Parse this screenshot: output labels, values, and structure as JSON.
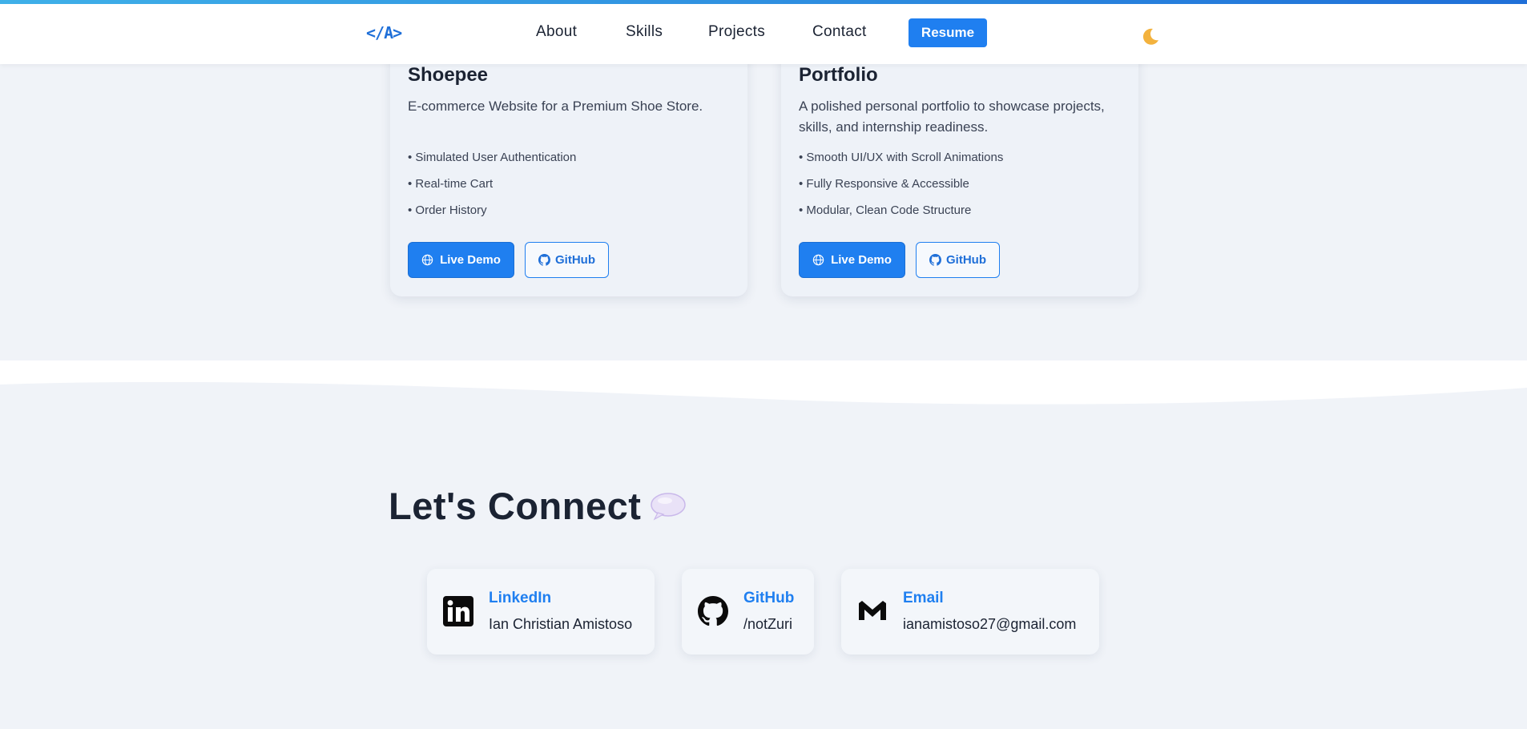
{
  "nav": {
    "logo": "</A>",
    "links": [
      "About",
      "Skills",
      "Projects",
      "Contact"
    ],
    "resume": "Resume",
    "theme_toggle_icon": "moon-icon"
  },
  "projects": [
    {
      "title": "Shoepee",
      "description": "E-commerce Website for a Premium Shoe Store.",
      "features": [
        "• Simulated User Authentication",
        "• Real-time Cart",
        "• Order History"
      ],
      "demo_label": "Live Demo",
      "github_label": "GitHub"
    },
    {
      "title": "Portfolio",
      "description": "A polished personal portfolio to showcase projects, skills, and internship readiness.",
      "features": [
        "• Smooth UI/UX with Scroll Animations",
        "• Fully Responsive & Accessible",
        "• Modular, Clean Code Structure"
      ],
      "demo_label": "Live Demo",
      "github_label": "GitHub"
    }
  ],
  "connect": {
    "title": "Let's Connect",
    "title_icon": "speech-bubble-icon",
    "contacts": [
      {
        "label": "LinkedIn",
        "value": "Ian Christian Amistoso",
        "icon": "linkedin-icon"
      },
      {
        "label": "GitHub",
        "value": "/notZuri",
        "icon": "github-icon"
      },
      {
        "label": "Email",
        "value": "ianamistoso27@gmail.com",
        "icon": "gmail-icon"
      }
    ]
  },
  "colors": {
    "accent": "#1f7ff0",
    "page_bg": "#f0f3f8",
    "text_dark": "#1b2333"
  }
}
